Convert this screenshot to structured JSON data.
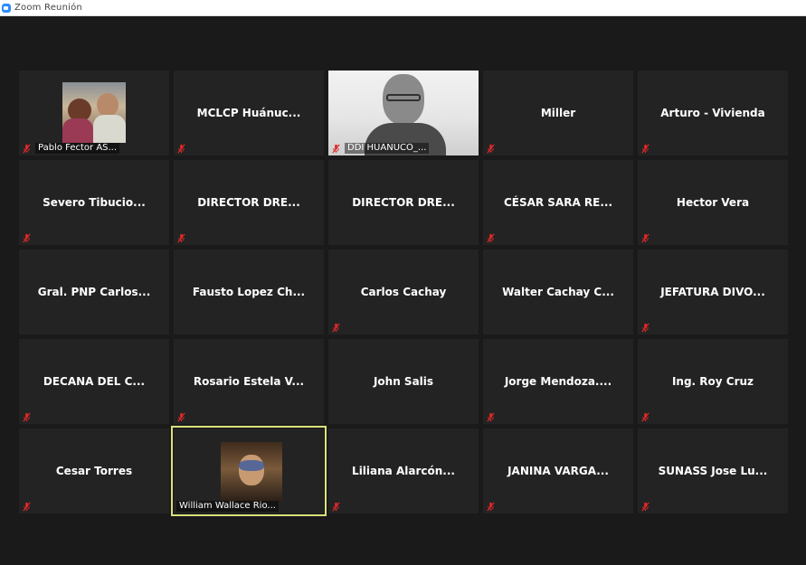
{
  "window": {
    "title": "Zoom Reunión",
    "icon": "zoom-app-icon"
  },
  "colors": {
    "background": "#1a1a1a",
    "tile": "#232323",
    "active_border": "#d9e17a",
    "muted_mic": "#e02828"
  },
  "participants": [
    {
      "name": "",
      "label": "Pablo Fector AS...",
      "muted": true,
      "media": "photo"
    },
    {
      "name": "MCLCP  Huánuc...",
      "label": "",
      "muted": true,
      "media": "none"
    },
    {
      "name": "",
      "label": "DDI HUANUCO_...",
      "muted": true,
      "media": "video"
    },
    {
      "name": "Miller",
      "label": "",
      "muted": true,
      "media": "none"
    },
    {
      "name": "Arturo - Vivienda",
      "label": "",
      "muted": true,
      "media": "none"
    },
    {
      "name": "Severo  Tibucio...",
      "label": "",
      "muted": true,
      "media": "none"
    },
    {
      "name": "DIRECTOR  DRE...",
      "label": "",
      "muted": true,
      "media": "none"
    },
    {
      "name": "DIRECTOR  DRE...",
      "label": "",
      "muted": false,
      "media": "none"
    },
    {
      "name": "CÉSAR SARA RE...",
      "label": "",
      "muted": true,
      "media": "none"
    },
    {
      "name": "Hector Vera",
      "label": "",
      "muted": true,
      "media": "none"
    },
    {
      "name": "Gral. PNP Carlos...",
      "label": "",
      "muted": false,
      "media": "none"
    },
    {
      "name": "Fausto Lopez Ch...",
      "label": "",
      "muted": false,
      "media": "none"
    },
    {
      "name": "Carlos Cachay",
      "label": "",
      "muted": true,
      "media": "none"
    },
    {
      "name": "Walter  Cachay  C...",
      "label": "",
      "muted": false,
      "media": "none"
    },
    {
      "name": "JEFATURA DIVO...",
      "label": "",
      "muted": true,
      "media": "none"
    },
    {
      "name": "DECANA DEL C...",
      "label": "",
      "muted": true,
      "media": "none"
    },
    {
      "name": "Rosario Estela V...",
      "label": "",
      "muted": true,
      "media": "none"
    },
    {
      "name": "John Salis",
      "label": "",
      "muted": false,
      "media": "none"
    },
    {
      "name": "Jorge  Mendoza....",
      "label": "",
      "muted": true,
      "media": "none"
    },
    {
      "name": "Ing. Roy Cruz",
      "label": "",
      "muted": true,
      "media": "none"
    },
    {
      "name": "Cesar Torres",
      "label": "",
      "muted": true,
      "media": "none"
    },
    {
      "name": "",
      "label": "William Wallace Rio...",
      "muted": false,
      "media": "avatar",
      "active": true
    },
    {
      "name": "Liliana  Alarcón...",
      "label": "",
      "muted": true,
      "media": "none"
    },
    {
      "name": "JANINA VARGA...",
      "label": "",
      "muted": true,
      "media": "none"
    },
    {
      "name": "SUNASS Jose Lu...",
      "label": "",
      "muted": true,
      "media": "none"
    }
  ]
}
